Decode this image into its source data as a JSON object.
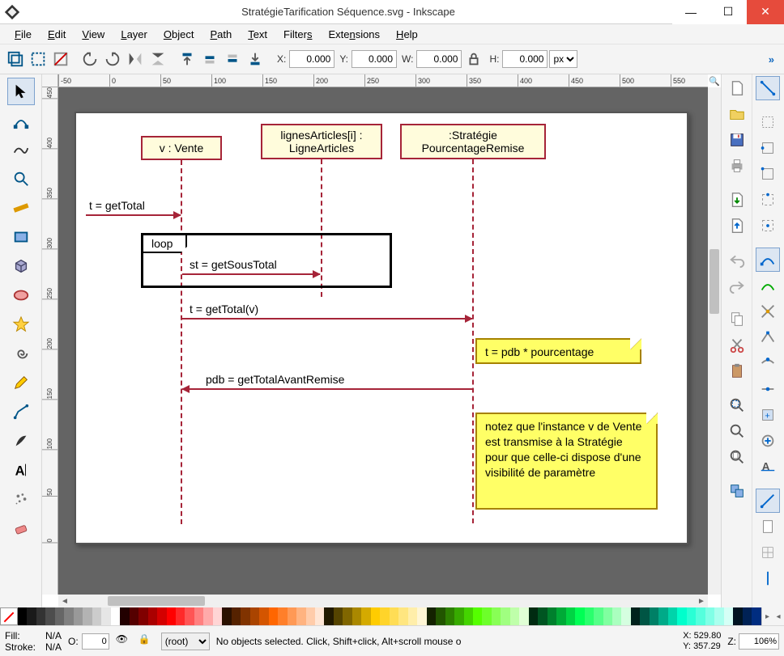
{
  "window": {
    "title": "StratégieTarification Séquence.svg - Inkscape"
  },
  "menu": {
    "file": "File",
    "edit": "Edit",
    "view": "View",
    "layer": "Layer",
    "object": "Object",
    "path": "Path",
    "text": "Text",
    "filters": "Filters",
    "extensions": "Extensions",
    "help": "Help"
  },
  "toolbar": {
    "x_label": "X:",
    "x_value": "0.000",
    "y_label": "Y:",
    "y_value": "0.000",
    "w_label": "W:",
    "w_value": "0.000",
    "h_label": "H:",
    "h_value": "0.000",
    "unit": "px"
  },
  "ruler_h_ticks": [
    "-50",
    "0",
    "50",
    "100",
    "150",
    "200",
    "250",
    "300",
    "350",
    "400",
    "450",
    "500",
    "550"
  ],
  "ruler_v_ticks": [
    "450",
    "400",
    "350",
    "300",
    "250",
    "200",
    "150",
    "100",
    "50",
    "0"
  ],
  "diagram": {
    "lifelines": [
      {
        "label": "v : Vente"
      },
      {
        "label": "lignesArticles[i] :\nLigneArticles"
      },
      {
        "label": ":Stratégie\nPourcentageRemise"
      }
    ],
    "loop_label": "loop",
    "messages": {
      "m1": "t = getTotal",
      "m2": "st = getSousTotal",
      "m3": "t = getTotal(v)",
      "m4": "pdb = getTotalAvantRemise"
    },
    "notes": {
      "n1": "t = pdb * pourcentage",
      "n2": "notez que l'instance v de Vente est transmise à la Stratégie pour que celle-ci dispose d'une visibilité de paramètre"
    }
  },
  "status": {
    "fill_label": "Fill:",
    "fill_value": "N/A",
    "stroke_label": "Stroke:",
    "stroke_value": "N/A",
    "opacity_label": "O:",
    "opacity_value": "0",
    "layer_value": "(root)",
    "message": "No objects selected. Click, Shift+click, Alt+scroll mouse o",
    "cursor_x_label": "X:",
    "cursor_x": "529.80",
    "cursor_y_label": "Y:",
    "cursor_y": "357.29",
    "zoom_label": "Z:",
    "zoom_value": "106%"
  },
  "palette": [
    "#000000",
    "#1a1a1a",
    "#333333",
    "#4d4d4d",
    "#666666",
    "#808080",
    "#999999",
    "#b3b3b3",
    "#cccccc",
    "#e6e6e6",
    "#ffffff",
    "#220000",
    "#550000",
    "#800000",
    "#aa0000",
    "#d40000",
    "#ff0000",
    "#ff2a2a",
    "#ff5555",
    "#ff8080",
    "#ffaaaa",
    "#ffd5d5",
    "#2b1100",
    "#552200",
    "#803300",
    "#aa4400",
    "#d45500",
    "#ff6600",
    "#ff7f2a",
    "#ff9955",
    "#ffb380",
    "#ffccaa",
    "#ffe6d5",
    "#221a00",
    "#554400",
    "#806600",
    "#aa8800",
    "#d4aa00",
    "#ffcc00",
    "#ffd42a",
    "#ffdd55",
    "#ffe680",
    "#ffeeaa",
    "#fff6d5",
    "#142200",
    "#225500",
    "#2d8000",
    "#37aa00",
    "#44d400",
    "#55ff00",
    "#6dff2a",
    "#88ff55",
    "#a0ff80",
    "#bfffaa",
    "#e0ffd5",
    "#002b11",
    "#005522",
    "#00802d",
    "#00aa37",
    "#00d444",
    "#00ff55",
    "#2aff6d",
    "#55ff88",
    "#80ffa0",
    "#aaffbf",
    "#d5ffe0",
    "#00221c",
    "#005544",
    "#008066",
    "#00aa88",
    "#00d4aa",
    "#00ffcc",
    "#2affd5",
    "#55ffdd",
    "#80ffe6",
    "#aaffee",
    "#d5fff6",
    "#001422",
    "#002255",
    "#002d80"
  ]
}
